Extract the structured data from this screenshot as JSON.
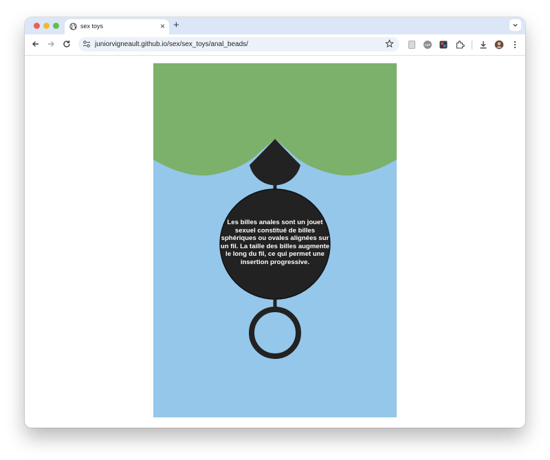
{
  "browser": {
    "tab_title": "sex toys",
    "new_tab_label": "+",
    "url": "juniorvigneault.github.io/sex/sex_toys/anal_beads/"
  },
  "poster": {
    "colors": {
      "sky": "#94c7ea",
      "green": "#7bb16a",
      "bead": "#222222"
    },
    "description": "Les billes anales sont un jouet sexuel constitué de billes sphériques ou ovales alignées sur un fil. La taille des billes augmente le long du fil, ce qui permet une insertion progressive."
  }
}
